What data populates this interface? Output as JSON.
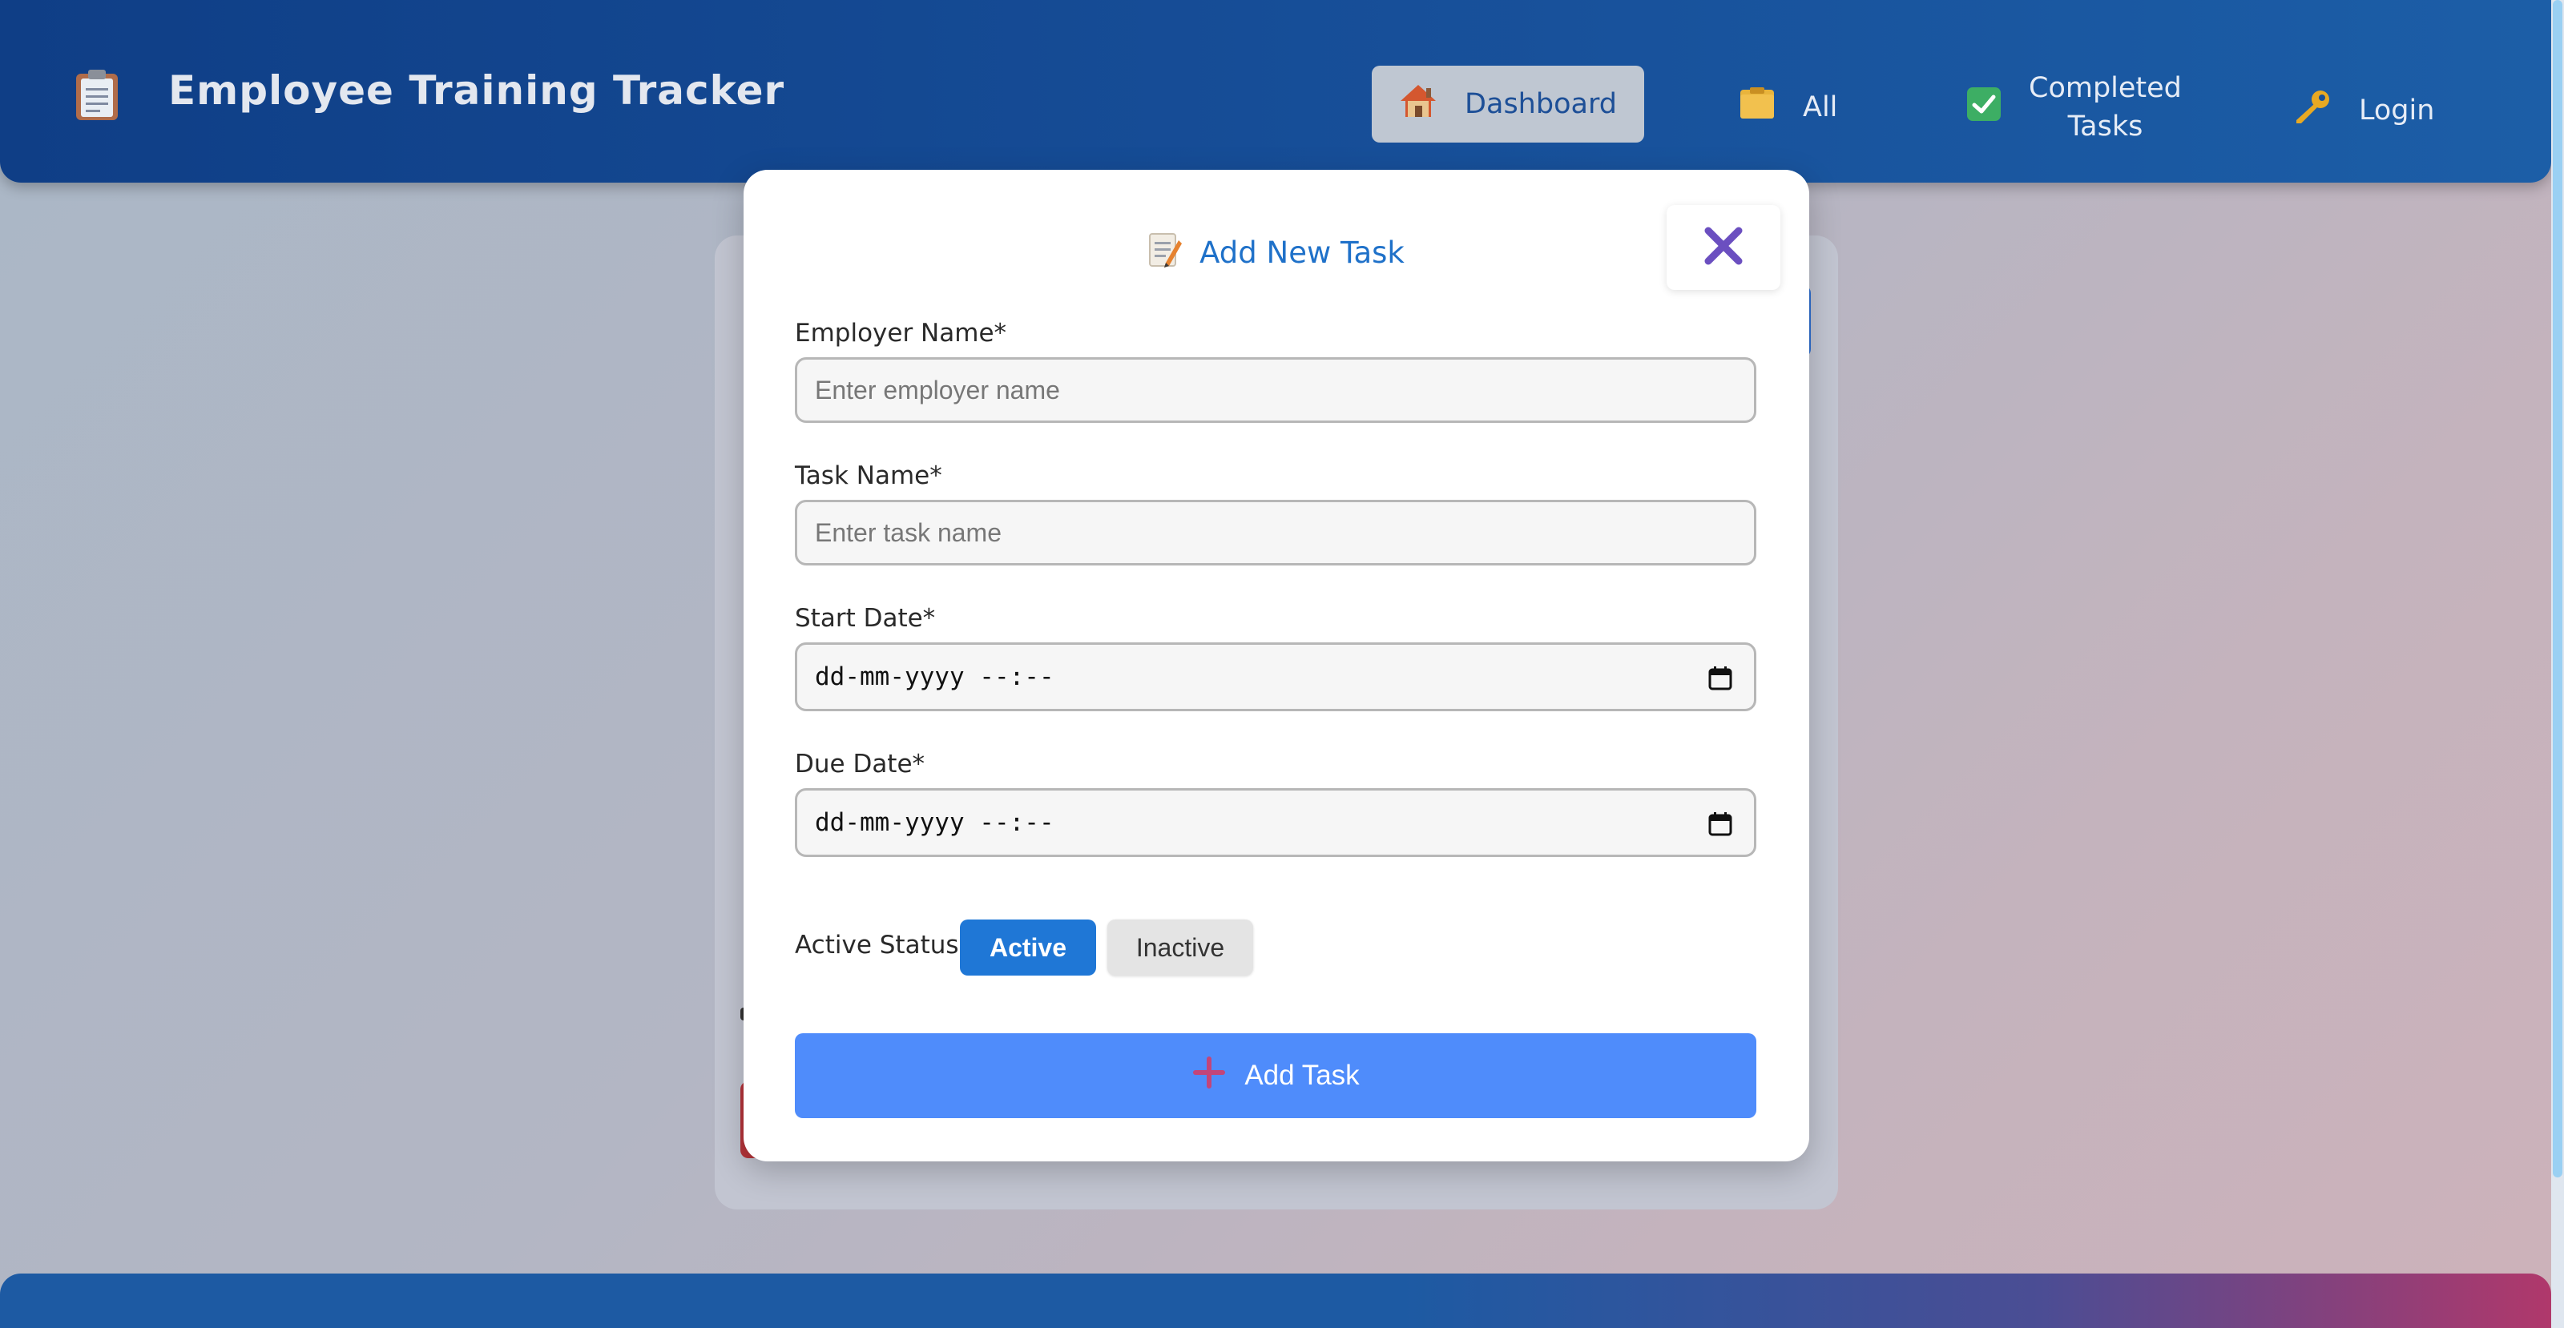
{
  "header": {
    "app_title": "Employee Training Tracker",
    "app_icon": "clipboard-icon",
    "nav": [
      {
        "label": "Dashboard",
        "icon": "house-icon",
        "active": true
      },
      {
        "label": "All",
        "icon": "folder-icon"
      },
      {
        "label_line1": "Completed",
        "label_line2": "Tasks",
        "icon": "check-icon"
      },
      {
        "label": "Login",
        "icon": "key-icon"
      }
    ]
  },
  "modal": {
    "title": "Add New Task",
    "title_icon": "memo-icon",
    "close_icon": "close-icon",
    "fields": {
      "employer_name": {
        "label": "Employer Name*",
        "placeholder": "Enter employer name",
        "value": ""
      },
      "task_name": {
        "label": "Task Name*",
        "placeholder": "Enter task name",
        "value": ""
      },
      "start_date": {
        "label": "Start Date*",
        "value": "dd-mm-yyyy --:--"
      },
      "due_date": {
        "label": "Due Date*",
        "value": "dd-mm-yyyy --:--"
      }
    },
    "status": {
      "label": "Active Status:",
      "options": [
        "Active",
        "Inactive"
      ],
      "selected": "Active"
    },
    "submit_label": "Add Task",
    "submit_icon": "plus-icon"
  },
  "colors": {
    "header_blue": "#174f99",
    "accent_blue": "#1f77d6",
    "submit_blue": "#4f8cfb",
    "title_blue": "#1f71c9",
    "close_purple": "#6b4fc0"
  }
}
